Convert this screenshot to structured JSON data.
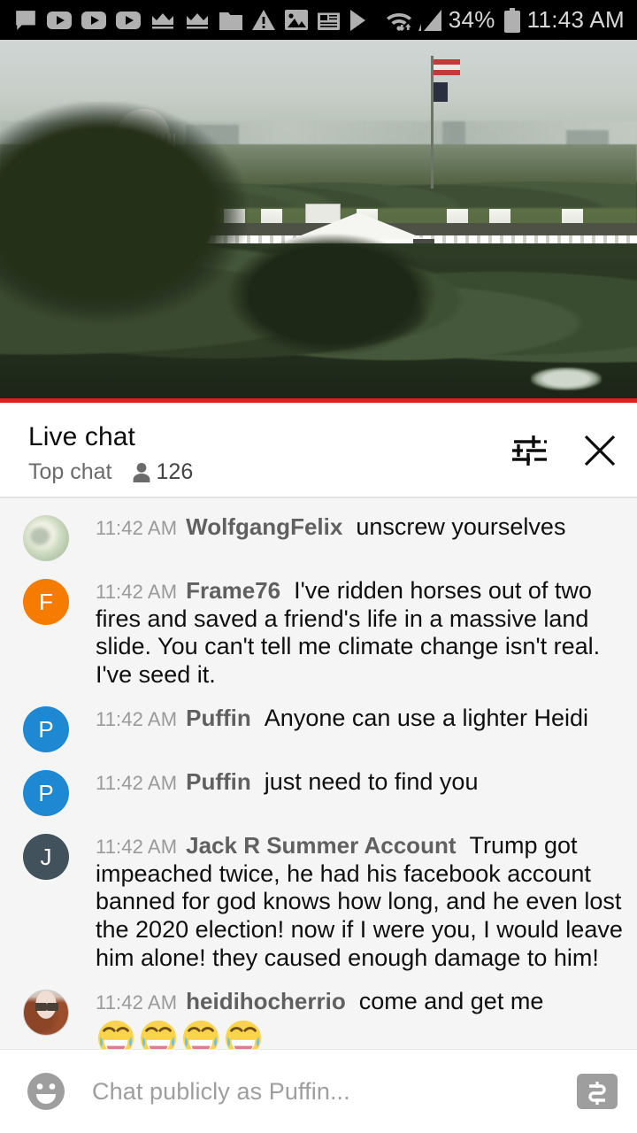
{
  "status_bar": {
    "battery_percent": "34%",
    "time": "11:43 AM",
    "left_icons": [
      "message-icon",
      "youtube-icon",
      "youtube-icon",
      "youtube-icon",
      "crown-icon",
      "crown-icon",
      "folder-icon",
      "warning-icon",
      "image-icon",
      "news-icon",
      "play-store-icon"
    ],
    "right_icons": [
      "wifi-icon",
      "signal-icon",
      "battery-icon"
    ]
  },
  "video": {
    "scene": "White House live stream",
    "live_indicator_color": "#e02020"
  },
  "chat_header": {
    "title": "Live chat",
    "mode": "Top chat",
    "viewer_count": "126",
    "settings_icon": "tune-icon",
    "close_icon": "close-icon"
  },
  "messages": [
    {
      "time": "11:42 AM",
      "author": "WolfgangFelix",
      "text": "unscrew yourselves",
      "avatar_type": "photo-a",
      "avatar_initial": "",
      "avatar_color": "#cfdcc2"
    },
    {
      "time": "11:42 AM",
      "author": "Frame76",
      "text": "I've ridden horses out of two fires and saved a friend's life in a massive land slide. You can't tell me climate change isn't real. I've seed it.",
      "avatar_type": "initial",
      "avatar_initial": "F",
      "avatar_color": "#f57c00"
    },
    {
      "time": "11:42 AM",
      "author": "Puffin",
      "text": "Anyone can use a lighter Heidi",
      "avatar_type": "initial",
      "avatar_initial": "P",
      "avatar_color": "#1e88d3"
    },
    {
      "time": "11:42 AM",
      "author": "Puffin",
      "text": "just need to find you",
      "avatar_type": "initial",
      "avatar_initial": "P",
      "avatar_color": "#1e88d3"
    },
    {
      "time": "11:42 AM",
      "author": "Jack R Summer Account",
      "text": "Trump got impeached twice, he had his facebook account banned for god knows how long, and he even lost the 2020 election! now if I were you, I would leave him alone! they caused enough damage to him!",
      "avatar_type": "initial",
      "avatar_initial": "J",
      "avatar_color": "#41525c"
    },
    {
      "time": "11:42 AM",
      "author": "heidihocherrio",
      "text": "come and get me",
      "emojis": "joy joy joy joy",
      "emoji_count": 4,
      "avatar_type": "photo-b",
      "avatar_initial": "",
      "avatar_color": "#a9603c"
    }
  ],
  "input_bar": {
    "emoji_icon": "smiley-icon",
    "placeholder": "Chat publicly as Puffin...",
    "super_chat_icon": "dollar-icon",
    "super_chat_label": "$"
  },
  "colors": {
    "accent_red": "#e02020",
    "chat_background": "#f5f5f5",
    "header_background": "#ffffff",
    "status_bar_background": "#000000"
  }
}
